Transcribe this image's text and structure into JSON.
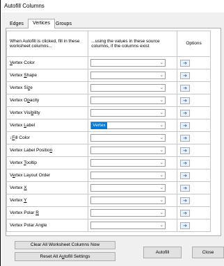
{
  "window": {
    "title": "Autofill Columns"
  },
  "tabs": [
    {
      "label": "Edges"
    },
    {
      "label": "Vertices"
    },
    {
      "label": "Groups"
    }
  ],
  "table": {
    "headers": [
      "When Autofill is clicked, fill in these worksheet columns...",
      "...using the values in these source columns, if the columns exist",
      "Options"
    ],
    "rows": [
      {
        "pre": "",
        "u": "V",
        "post": "ertex Color",
        "value": ""
      },
      {
        "pre": "Vertex ",
        "u": "S",
        "post": "hape",
        "value": ""
      },
      {
        "pre": "Vertex Si",
        "u": "z",
        "post": "e",
        "value": ""
      },
      {
        "pre": "Vertex O",
        "u": "p",
        "post": "acity",
        "value": ""
      },
      {
        "pre": "Vertex Visi",
        "u": "b",
        "post": "ility",
        "value": ""
      },
      {
        "pre": "Vertex ",
        "u": "L",
        "post": "abel",
        "value": "Vertex"
      },
      {
        "pre": "↓",
        "u": "F",
        "post": "ill Color",
        "value": ""
      },
      {
        "pre": "Vertex Label Positio",
        "u": "n",
        "post": "",
        "value": ""
      },
      {
        "pre": "Vertex ",
        "u": "T",
        "post": "ooltip",
        "value": ""
      },
      {
        "pre": "V",
        "u": "e",
        "post": "rtex Layout Order",
        "value": ""
      },
      {
        "pre": "Vertex ",
        "u": "X",
        "post": "",
        "value": ""
      },
      {
        "pre": "Vertex ",
        "u": "Y",
        "post": "",
        "value": ""
      },
      {
        "pre": "Vertex Polar ",
        "u": "R",
        "post": "",
        "value": ""
      },
      {
        "pre": "Vertex Polar Angle",
        "u": "",
        "post": "",
        "value": ""
      }
    ]
  },
  "buttons": {
    "clear_all": "Clear All Worksheet Columns Now",
    "reset_all_pre": "Reset All A",
    "reset_all_u": "u",
    "reset_all_post": "tofill Settings",
    "autofill": "Autofill",
    "close": "Close"
  },
  "icons": {
    "dropdown": "chevron-down-icon",
    "options": "arrow-right-icon"
  }
}
